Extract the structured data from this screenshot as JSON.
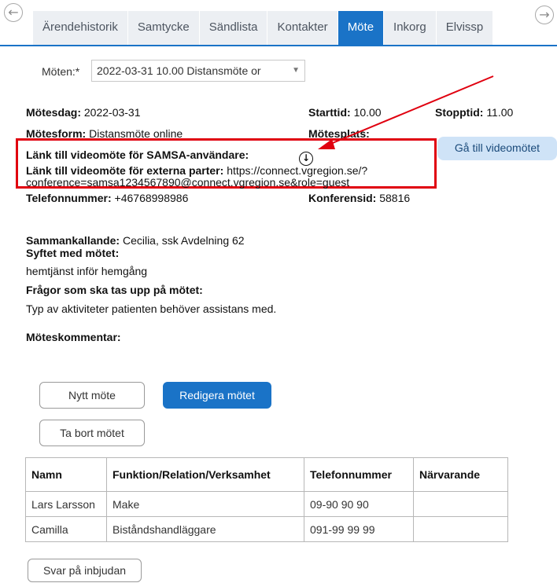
{
  "tabs": [
    {
      "label": "Ärendehistorik",
      "active": false
    },
    {
      "label": "Samtycke",
      "active": false
    },
    {
      "label": "Sändlista",
      "active": false
    },
    {
      "label": "Kontakter",
      "active": false
    },
    {
      "label": "Möte",
      "active": true
    },
    {
      "label": "Inkorg",
      "active": false
    },
    {
      "label": "Elvissp",
      "active": false
    }
  ],
  "meeting_selector": {
    "label": "Möten:*",
    "value": "2022-03-31 10.00 Distansmöte or"
  },
  "details": {
    "date_label": "Mötesdag:",
    "date_value": "2022-03-31",
    "start_label": "Starttid:",
    "start_value": "10.00",
    "stop_label": "Stopptid:",
    "stop_value": "11.00",
    "form_label": "Mötesform:",
    "form_value": "Distansmöte online",
    "place_label": "Mötesplats:",
    "samsa_link_label": "Länk till videomöte för SAMSA-användare:",
    "external_link_label": "Länk till videomöte för externa parter:",
    "external_link_value_1": "https://connect.vgregion.se/?",
    "external_link_value_2": "conference=samsa1234567890@connect.vgregion.se&role=guest",
    "phone_label": "Telefonnummer:",
    "phone_value": "+46768998986",
    "conf_label": "Konferensid:",
    "conf_value": "58816",
    "convener_label": "Sammankallande:",
    "convener_value": "Cecilia, ssk Avdelning 62",
    "purpose_label": "Syftet med mötet:",
    "purpose_value": "hemtjänst inför hemgång",
    "questions_label": "Frågor som ska tas upp på mötet:",
    "questions_value": "Typ av aktiviteter patienten behöver assistans med.",
    "comment_label": "Möteskommentar:"
  },
  "buttons": {
    "go_to_video": "Gå till videomötet",
    "new_meeting": "Nytt möte",
    "edit_meeting": "Redigera mötet",
    "delete_meeting": "Ta bort mötet",
    "reply_invite": "Svar på inbjudan"
  },
  "participants": {
    "headers": [
      "Namn",
      "Funktion/Relation/Verksamhet",
      "Telefonnummer",
      "Närvarande"
    ],
    "rows": [
      [
        "Lars Larsson",
        "Make",
        "09-90 90 90",
        ""
      ],
      [
        "Camilla",
        "Biståndshandläggare",
        "091-99 99 99",
        ""
      ]
    ]
  },
  "colors": {
    "accent": "#1a73c7",
    "highlight_box": "#e0000f",
    "annotation_arrow": "#e0000f"
  },
  "icons": {
    "prev": "circle-arrow-left-icon",
    "next": "circle-arrow-right-icon",
    "samsa_link": "circle-arrow-down-icon",
    "dropdown": "chevron-down-icon"
  }
}
